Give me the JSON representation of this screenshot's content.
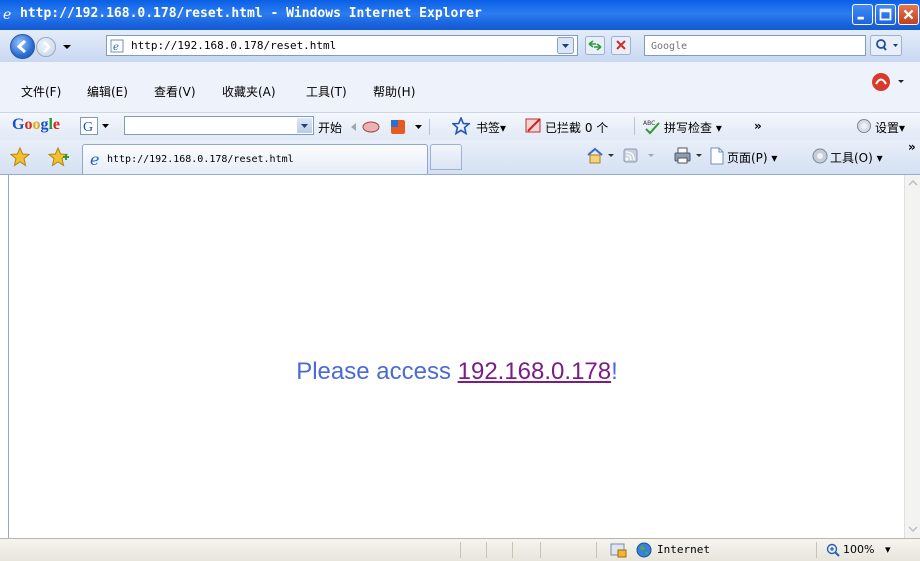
{
  "window": {
    "title": "http://192.168.0.178/reset.html - Windows Internet Explorer"
  },
  "address": {
    "url": "http://192.168.0.178/reset.html"
  },
  "search": {
    "placeholder": "Google"
  },
  "menu": {
    "items": [
      "文件(F)",
      "编辑(E)",
      "查看(V)",
      "收藏夹(A)",
      "工具(T)",
      "帮助(H)"
    ]
  },
  "google_toolbar": {
    "logo": "Google",
    "start_label": "开始",
    "bookmarks_label": "书签",
    "blocked_label": "已拦截 0 个",
    "spellcheck_label": "拼写检查",
    "more_label": "»",
    "settings_label": "设置"
  },
  "tabs": {
    "active_title": "http://192.168.0.178/reset.html",
    "page_label": "页面(P)",
    "tools_label": "工具(O)",
    "more_label": "»"
  },
  "content": {
    "message_prefix": "Please access ",
    "link_text": "192.168.0.178",
    "message_suffix": "!"
  },
  "status": {
    "zone": "Internet",
    "zoom": "100%"
  },
  "colors": {
    "titlebar": "#1a63de",
    "message": "#4a6bd6",
    "link": "#7b1d86"
  }
}
